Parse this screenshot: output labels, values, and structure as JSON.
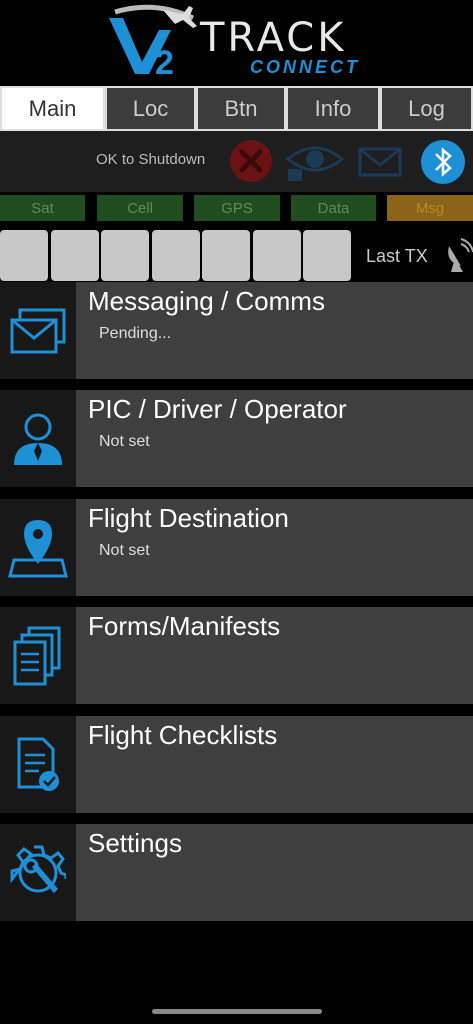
{
  "header": {
    "logo_track": "TRACK",
    "logo_connect": "CONNECT",
    "logo_v": "V",
    "logo_2": "2"
  },
  "tabs": [
    {
      "label": "Main",
      "active": true
    },
    {
      "label": "Loc",
      "active": false
    },
    {
      "label": "Btn",
      "active": false
    },
    {
      "label": "Info",
      "active": false
    },
    {
      "label": "Log",
      "active": false
    }
  ],
  "status": {
    "shutdown_text": "OK to Shutdown",
    "icons": [
      "error-x-icon",
      "eye-lock-icon",
      "mail-icon",
      "bluetooth-icon"
    ]
  },
  "indicators": [
    {
      "label": "Sat",
      "state": "green"
    },
    {
      "label": "Cell",
      "state": "green"
    },
    {
      "label": "GPS",
      "state": "green"
    },
    {
      "label": "Data",
      "state": "green"
    },
    {
      "label": "Msg",
      "state": "orange"
    }
  ],
  "tx": {
    "label": "Last TX",
    "icon": "satellite-dish-icon"
  },
  "menu": [
    {
      "title": "Messaging / Comms",
      "subtitle": "Pending...",
      "icon": "envelopes-icon"
    },
    {
      "title": "PIC / Driver / Operator",
      "subtitle": "Not set",
      "icon": "person-icon"
    },
    {
      "title": "Flight Destination",
      "subtitle": "Not set",
      "icon": "map-pin-icon"
    },
    {
      "title": "Forms/Manifests",
      "subtitle": "",
      "icon": "documents-icon"
    },
    {
      "title": "Flight Checklists",
      "subtitle": "",
      "icon": "checklist-icon"
    },
    {
      "title": "Settings",
      "subtitle": "",
      "icon": "gear-wrench-icon"
    }
  ],
  "colors": {
    "accent": "#1e90d6",
    "indicator_green": "#1f4d1f",
    "indicator_orange": "#8a6418",
    "error_red": "#6b1212"
  }
}
